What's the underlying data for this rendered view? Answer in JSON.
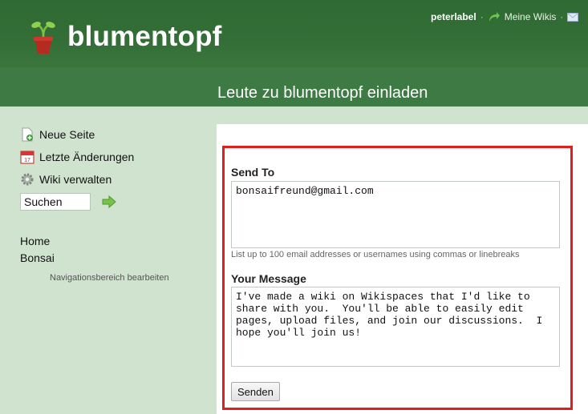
{
  "header": {
    "brand": "blumentopf",
    "user": "peterlabel",
    "my_wikis": "Meine Wikis"
  },
  "page": {
    "title": "Leute zu blumentopf einladen"
  },
  "sidebar": {
    "items": [
      {
        "label": "Neue Seite",
        "icon": "new-page-icon"
      },
      {
        "label": "Letzte Änderungen",
        "icon": "calendar-icon"
      },
      {
        "label": "Wiki verwalten",
        "icon": "gear-icon"
      }
    ],
    "search": {
      "value": "Suchen"
    },
    "links": [
      "Home",
      "Bonsai"
    ],
    "edit_nav": "Navigationsbereich bearbeiten"
  },
  "form": {
    "send_to_label": "Send To",
    "send_to_value": "bonsaifreund@gmail.com",
    "hint": "List up to 100 email addresses or usernames using commas or linebreaks",
    "message_label": "Your Message",
    "message_value": "I've made a wiki on Wikispaces that I'd like to share with you.  You'll be able to easily edit pages, upload files, and join our discussions.  I hope you'll join us!",
    "submit": "Senden"
  },
  "colors": {
    "header_green": "#336e37",
    "sidebar_green": "#cfe3cf",
    "highlight_red": "#e01e1e"
  }
}
